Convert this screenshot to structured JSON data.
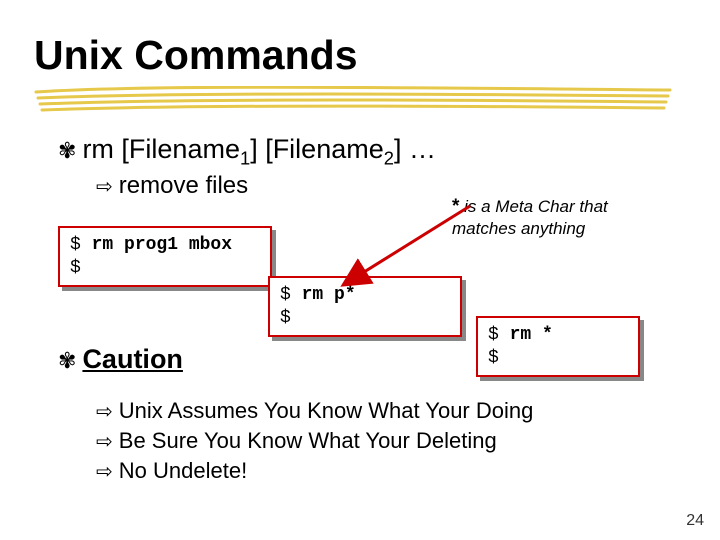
{
  "title": "Unix Commands",
  "cmd": {
    "pre": "rm [Filename",
    "sub1": "1",
    "mid": "] [Filename",
    "sub2": "2",
    "post": "] …"
  },
  "remove_files": "remove files",
  "note_star": "*",
  "note_text": " is a Meta Char that\nmatches anything",
  "code1": "$ rm prog1 mbox\n$",
  "code1_cmd": "rm prog1 mbox",
  "code2_cmd": "rm p*",
  "code3_cmd": "rm *",
  "caution": "Caution",
  "bullets": [
    "Unix Assumes You Know What Your Doing",
    "Be Sure You Know What Your Deleting",
    "No Undelete!"
  ],
  "page": "24"
}
